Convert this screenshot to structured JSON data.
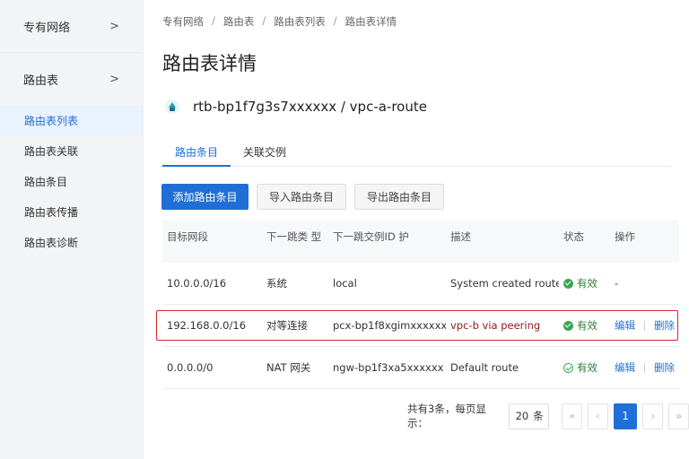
{
  "sidebar": {
    "groups": [
      {
        "label": "专有网络",
        "chevron": ">"
      },
      {
        "label": "路由表",
        "chevron": ">"
      }
    ],
    "items": [
      {
        "label": "路由表列表",
        "active": true
      },
      {
        "label": "路由表关联"
      },
      {
        "label": "路由条目"
      },
      {
        "label": "路由表传播"
      },
      {
        "label": "路由表诊断"
      }
    ]
  },
  "breadcrumb": [
    "专有网络",
    "路由表",
    "路由表列表",
    "路由表详情"
  ],
  "page_title": "路由表详情",
  "resource": {
    "name": "rtb-bp1f7g3s7xxxxxx / vpc-a-route"
  },
  "tabs": [
    {
      "label": "路由条目",
      "active": true
    },
    {
      "label": "关联交例"
    }
  ],
  "toolbar": {
    "add_label": "添加路由条目",
    "import_label": "导入路由条目",
    "export_label": "导出路由条目"
  },
  "table": {
    "headers": [
      "目标网段",
      "下一跳类 型",
      "下一跳交例ID 护",
      "描述",
      "状态",
      "操作"
    ],
    "rows": [
      {
        "dest": "10.0.0.0/16",
        "type": "系统",
        "id": "local",
        "desc": "System created route.",
        "status": "有效",
        "edit": "-",
        "del": ""
      },
      {
        "dest": "192.168.0.0/16",
        "type": "对等连接",
        "id": "pcx-bp1f8xgimxxxxxx",
        "desc": "vpc-b via peering",
        "status": "有效",
        "edit": "编辑",
        "del": "删除"
      },
      {
        "dest": "0.0.0.0/0",
        "type": "NAT 网关",
        "id": "ngw-bp1f3xa5xxxxxx",
        "desc": "Default route",
        "status": "有效",
        "edit": "编辑",
        "del": "删除"
      }
    ]
  },
  "pagination": {
    "total": "共有3条，每页显示：",
    "page_size": "20",
    "unit": "条",
    "first": "«",
    "prev": "‹",
    "current": "1",
    "next": "›",
    "last": "»"
  },
  "colors": {
    "accent": "#1f6fd6",
    "valid": "#3aa655",
    "highlight": "#d9252b"
  }
}
